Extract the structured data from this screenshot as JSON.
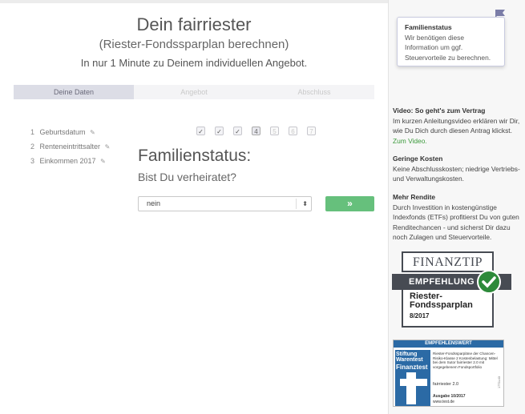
{
  "header": {
    "title": "Dein fairriester",
    "subtitle": "(Riester-Fondssparplan berechnen)",
    "tagline": "In nur 1 Minute zu Deinem individuellen Angebot."
  },
  "progress_tabs": [
    {
      "label": "Deine Daten",
      "active": true
    },
    {
      "label": "Angebot",
      "active": false
    },
    {
      "label": "Abschluss",
      "active": false
    }
  ],
  "completed_steps": [
    {
      "num": "1",
      "label": "Geburtsdatum"
    },
    {
      "num": "2",
      "label": "Renteneintrittsalter"
    },
    {
      "num": "3",
      "label": "Einkommen 2017"
    }
  ],
  "step_indicators": [
    "✓",
    "✓",
    "✓",
    "4",
    "5",
    "6",
    "7"
  ],
  "question": {
    "title": "Familienstatus:",
    "subtitle": "Bist Du verheiratet?",
    "select_value": "nein",
    "next_symbol": "»"
  },
  "tooltip": {
    "title": "Familienstatus",
    "text": "Wir benötigen diese Information um ggf. Steuervorteile zu berechnen."
  },
  "sidebar": {
    "video_heading": "Video: So geht's zum Vertrag",
    "video_text": "Im kurzen Anleitungsvideo erklären wir Dir, wie Du Dich durch diesen Antrag klickst.",
    "video_link": "Zum Video.",
    "costs_heading": "Geringe Kosten",
    "costs_text": "Keine Abschlusskosten; niedrige Vertriebs- und Verwaltungskosten.",
    "return_heading": "Mehr Rendite",
    "return_text": "Durch Investition in kostengünstige Indexfonds (ETFs) profitierst Du von guten Renditechancen - und sicherst Dir dazu noch Zulagen und Steuervorteile."
  },
  "finanztip_badge": {
    "brand": "FINANZTIP",
    "ribbon": "EMPFEHLUNG",
    "line1": "Riester-",
    "line2": "Fondssparplan",
    "date": "8/2017"
  },
  "warentest_badge": {
    "header": "EMPFEHLENSWERT",
    "logo1": "Stiftung",
    "logo2": "Warentest",
    "logo3": "Finanztest",
    "text": "Riester-Fondssparpläne der Chancen-Risiko-Klasse 2 Kostenbelastung: Mittel bei dem Sutor fairriester 2.0 mit vorgegebenem Fondsportfolio",
    "product": "fairriester 2.0",
    "issue": "Ausgabe 10/2017",
    "url": "www.test.de",
    "code": "17T1L43"
  },
  "colors": {
    "accent_green": "#66c07c",
    "active_tab": "#dcdde6",
    "badge_dark": "#474b53",
    "warentest_blue": "#2b6aa5"
  }
}
